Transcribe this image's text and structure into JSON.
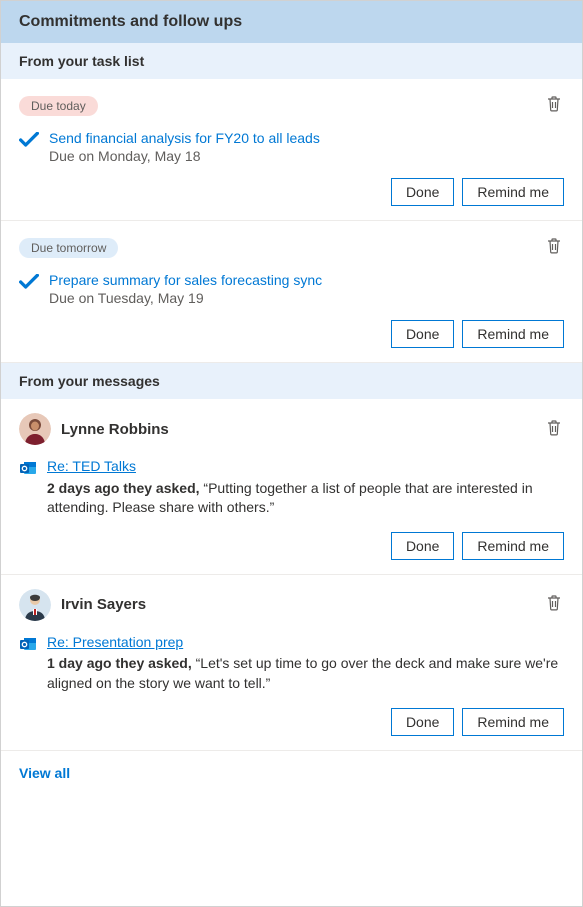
{
  "title": "Commitments and follow ups",
  "buttons": {
    "done": "Done",
    "remind": "Remind me"
  },
  "task_section": {
    "header": "From your task list",
    "items": [
      {
        "badge": "Due today",
        "badge_class": "badge-today",
        "title": "Send financial analysis for FY20 to all leads",
        "due": "Due on Monday, May 18"
      },
      {
        "badge": "Due tomorrow",
        "badge_class": "badge-tomorrow",
        "title": "Prepare summary for sales forecasting sync",
        "due": "Due on Tuesday, May 19"
      }
    ]
  },
  "message_section": {
    "header": "From your messages",
    "items": [
      {
        "sender": "Lynne Robbins",
        "subject": "Re: TED Talks",
        "meta": "2 days ago they asked,",
        "quote": " “Putting together a list of people that are interested in attending. Please share with others.”"
      },
      {
        "sender": "Irvin Sayers",
        "subject": "Re: Presentation prep",
        "meta": "1 day ago they asked,",
        "quote": " “Let's set up time to go over the deck and make sure we're aligned on the story we want to tell.”"
      }
    ]
  },
  "footer": {
    "view_all": "View all"
  }
}
